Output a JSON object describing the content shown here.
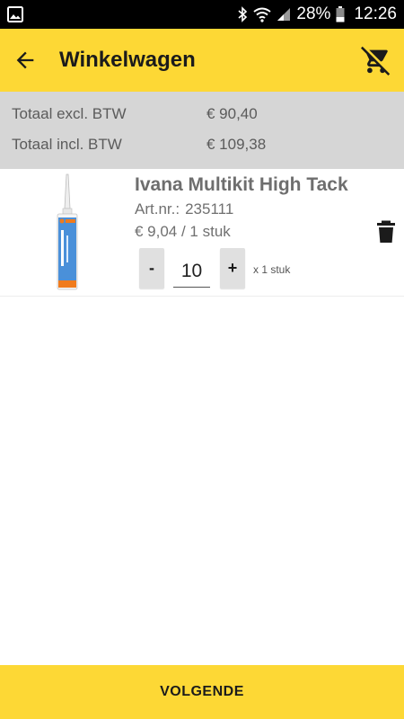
{
  "status_bar": {
    "battery_percent": "28%",
    "time": "12:26",
    "icons": [
      "gallery-icon",
      "bluetooth-icon",
      "wifi-icon",
      "signal-icon",
      "battery-icon"
    ]
  },
  "app_bar": {
    "title": "Winkelwagen",
    "back_icon": "arrow-back-icon",
    "clear_cart_icon": "remove-shopping-cart-icon"
  },
  "totals": {
    "excl_label": "Totaal excl. BTW",
    "excl_value": "€ 90,40",
    "incl_label": "Totaal incl. BTW",
    "incl_value": "€ 109,38"
  },
  "cart_items": [
    {
      "name": "Ivana Multikit High Tack",
      "art_label": "Art.nr.:",
      "art_number": "235111",
      "price": "€ 9,04 / 1 stuk",
      "quantity": "10",
      "minus_label": "-",
      "plus_label": "+",
      "unit_note": "x 1 stuk",
      "delete_icon": "trash-icon"
    }
  ],
  "footer": {
    "next_label": "VOLGENDE"
  },
  "colors": {
    "accent": "#fdd835",
    "summary_bg": "#d6d6d6",
    "status_bar": "#000000"
  }
}
